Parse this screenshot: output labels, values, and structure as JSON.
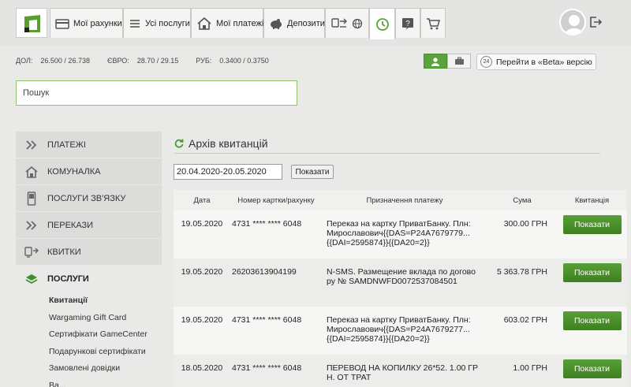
{
  "nav": {
    "tabs": [
      {
        "label": "Мої рахунки",
        "icon": "card-icon"
      },
      {
        "label": "Усі послуги",
        "icon": "list-icon"
      },
      {
        "label": "Мої платежі",
        "icon": "house-icon"
      },
      {
        "label": "Депозити",
        "icon": "piggy-icon"
      },
      {
        "label": "",
        "icon": "transfer-icon"
      },
      {
        "label": "",
        "icon": "refresh-icon"
      },
      {
        "label": "",
        "icon": "help-icon"
      },
      {
        "label": "",
        "icon": "cart-icon"
      }
    ]
  },
  "rates": {
    "usd_label": "ДОЛ:",
    "usd": "26.500 / 26.738",
    "eur_label": "ЄВРО:",
    "eur": "28.70 / 29.15",
    "rub_label": "РУБ:",
    "rub": "0.3400 / 0.3750"
  },
  "beta": {
    "badge": "24",
    "label": "Перейти в «Beta» версію"
  },
  "search": {
    "placeholder": "Пошук"
  },
  "sidebar": {
    "items": [
      {
        "label": "ПЛАТЕЖІ",
        "icon": "chevrons-icon"
      },
      {
        "label": "КОМУНАЛКА",
        "icon": "house-icon"
      },
      {
        "label": "ПОСЛУГИ ЗВ'ЯЗКУ",
        "icon": "phone-icon"
      },
      {
        "label": "ПЕРЕКАЗИ",
        "icon": "chevrons-icon"
      },
      {
        "label": "КВИТКИ",
        "icon": "train-icon"
      },
      {
        "label": "ПОСЛУГИ",
        "icon": "layers-icon"
      }
    ],
    "subitems": [
      "Квитанції",
      "Wargaming Gift Card",
      "Сертифікати GameCenter",
      "Подарункові сертифікати",
      "Замовлені довідки",
      "Ва..."
    ]
  },
  "main": {
    "title": "Архів квитанцій",
    "date_range": "20.04.2020-20.05.2020",
    "show_button": "Показати",
    "columns": [
      "Дата",
      "Номер картки/рахунку",
      "Призначення платежу",
      "Сума",
      "Квитанція"
    ],
    "rows": [
      {
        "date": "19.05.2020",
        "card": "4731 **** **** 6048",
        "purpose": "Переказ на картку ПриватБанку. Плн: Мирославович{{DAS=P24A7679779...{{DAI=2595874}}{{DA20=2}}",
        "sum": "300.00 ГРН",
        "btn": "Показати"
      },
      {
        "date": "19.05.2020",
        "card": "26203613904199",
        "purpose": "N-SMS. Размещение вклада по договору № SAMDNWFD0072537084501",
        "sum": "5 363.78 ГРН",
        "btn": "Показати"
      },
      {
        "date": "19.05.2020",
        "card": "4731 **** **** 6048",
        "purpose": "Переказ на картку ПриватБанку. Плн: Мирославович{{DAS=P24A7679277...{{DAI=2595874}}{{DA20=2}}",
        "sum": "603.02 ГРН",
        "btn": "Показати"
      },
      {
        "date": "18.05.2020",
        "card": "4731 **** **** 6048",
        "purpose": "ПЕРЕВОД НА КОПИЛКУ 26*52. 1.00 ГРН. ОТ ТРАТ",
        "sum": "1.00 ГРН",
        "btn": "Показати"
      }
    ]
  }
}
